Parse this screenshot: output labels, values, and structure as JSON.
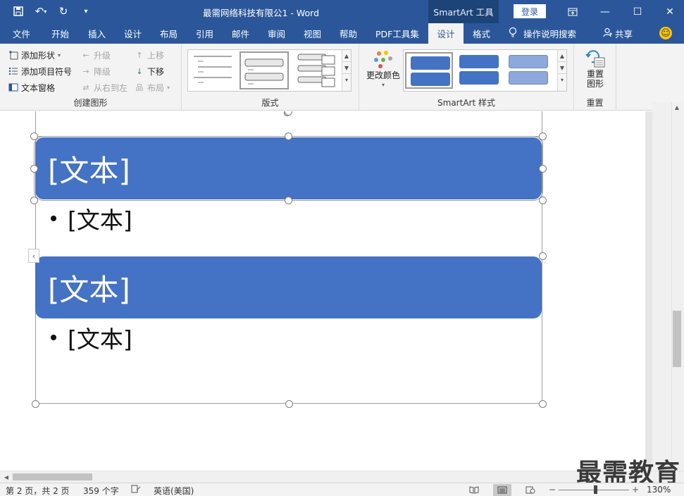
{
  "titlebar": {
    "doc_title": "最需网络科技有限公1  -  Word",
    "tool_context": "SmartArt 工具",
    "login": "登录"
  },
  "tabs": [
    {
      "label": "文件",
      "id": "file"
    },
    {
      "label": "开始",
      "id": "home"
    },
    {
      "label": "插入",
      "id": "insert"
    },
    {
      "label": "设计",
      "id": "design-doc"
    },
    {
      "label": "布局",
      "id": "layout"
    },
    {
      "label": "引用",
      "id": "references"
    },
    {
      "label": "邮件",
      "id": "mailings"
    },
    {
      "label": "审阅",
      "id": "review"
    },
    {
      "label": "视图",
      "id": "view"
    },
    {
      "label": "帮助",
      "id": "help"
    },
    {
      "label": "PDF工具集",
      "id": "pdf"
    },
    {
      "label": "设计",
      "id": "smartart-design",
      "active": true
    },
    {
      "label": "格式",
      "id": "format"
    }
  ],
  "tell_me": "操作说明搜索",
  "share": "共享",
  "ribbon": {
    "create_graphic": {
      "label": "创建图形",
      "add_shape": "添加形状",
      "add_bullet": "添加项目符号",
      "text_pane": "文本窗格",
      "promote": "升级",
      "demote": "降级",
      "right_to_left": "从右到左",
      "move_up": "上移",
      "move_down": "下移",
      "layout": "布局"
    },
    "layouts": {
      "label": "版式"
    },
    "smartart_styles": {
      "label": "SmartArt 样式",
      "change_colors": "更改颜色"
    },
    "reset": {
      "label": "重置",
      "reset_graphic_line1": "重置",
      "reset_graphic_line2": "图形"
    }
  },
  "smartart": {
    "shapes": [
      {
        "text": "[文本]",
        "bullet": "[文本]"
      },
      {
        "text": "[文本]",
        "bullet": "[文本]"
      }
    ]
  },
  "watermark": "最需教育",
  "status": {
    "page": "第 2 页，共 2 页",
    "words": "359 个字",
    "language": "英语(美国)",
    "zoom_minus": "−",
    "zoom_plus": "+",
    "zoom": "130%"
  },
  "colors": {
    "brand": "#2b579a",
    "shape_fill": "#4472c4"
  }
}
